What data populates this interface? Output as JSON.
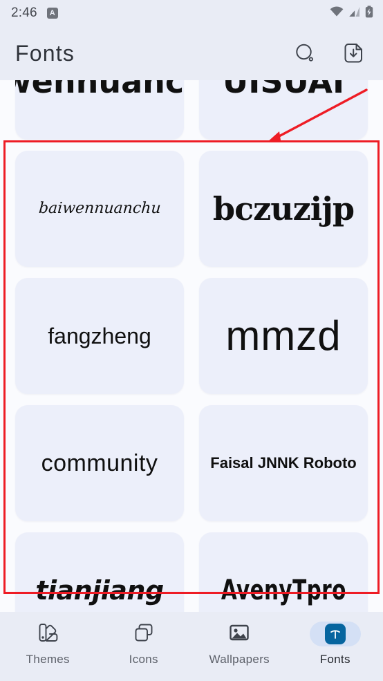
{
  "status_bar": {
    "time": "2:46",
    "notification_icon": "notification-badge-icon",
    "notification_letter": "A",
    "wifi_icon": "wifi-icon",
    "signal_icon": "cellular-signal-icon",
    "battery_icon": "battery-charging-icon"
  },
  "header": {
    "title": "Fonts",
    "search_icon": "search-icon",
    "download_icon": "file-download-icon"
  },
  "grid": {
    "cards": [
      {
        "sample": "aiwennuanchu",
        "style": "s-cut",
        "clipped": true
      },
      {
        "sample": "UISUAI",
        "style": "s-cut",
        "clipped": true
      },
      {
        "sample": "baiwennuanchu",
        "style": "s-handwrite",
        "clipped": false
      },
      {
        "sample": "bczuzijp",
        "style": "s-serif",
        "clipped": false
      },
      {
        "sample": "fangzheng",
        "style": "s-sans-small",
        "clipped": false
      },
      {
        "sample": "mmzd",
        "style": "s-sans-big",
        "clipped": false
      },
      {
        "sample": "community",
        "style": "s-thin",
        "clipped": false
      },
      {
        "sample": "Faisal JNNK Roboto",
        "style": "s-bold-small",
        "clipped": false
      },
      {
        "sample": "tianjiang",
        "style": "s-marker",
        "clipped": false
      },
      {
        "sample": "AvenyTpro",
        "style": "s-condensed",
        "clipped": false
      }
    ]
  },
  "bottom_nav": {
    "items": [
      {
        "label": "Themes",
        "icon": "palette-swatch-icon",
        "active": false
      },
      {
        "label": "Icons",
        "icon": "stacked-squares-icon",
        "active": false
      },
      {
        "label": "Wallpapers",
        "icon": "image-photo-icon",
        "active": false
      },
      {
        "label": "Fonts",
        "icon": "font-t-icon",
        "active": true
      }
    ]
  },
  "annotation": {
    "box_color": "#ee1c25",
    "arrow_color": "#ee1c25"
  },
  "colors": {
    "header_bg": "#e9ecf5",
    "page_bg": "#fafbfe",
    "card_bg": "#eceffa",
    "accent": "#06659f",
    "active_pill": "#d4e0f5"
  }
}
